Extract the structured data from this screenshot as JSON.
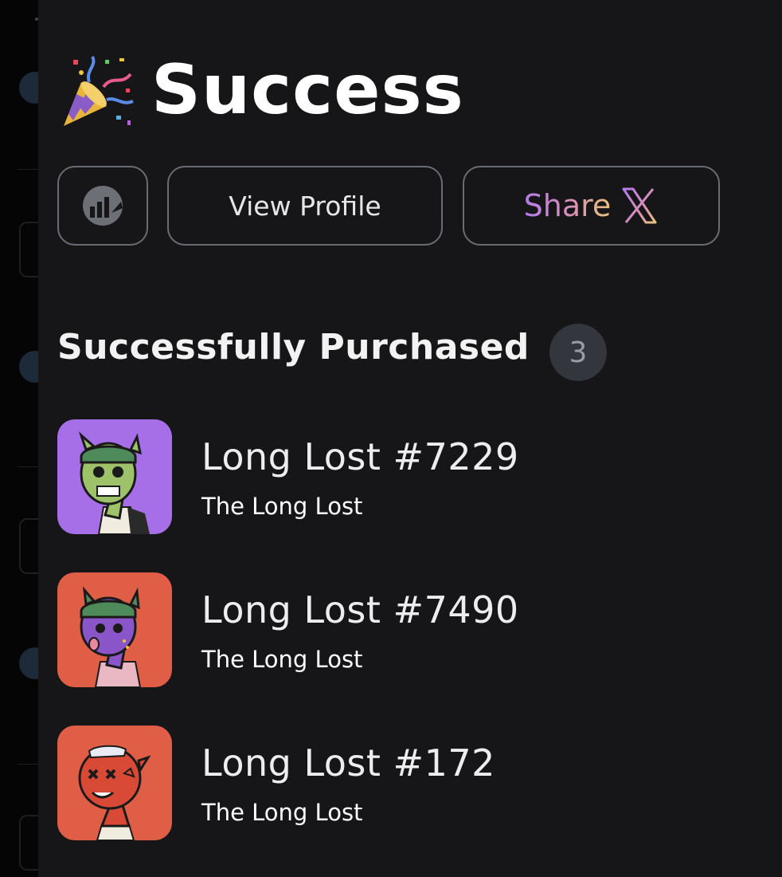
{
  "header": {
    "title": "Success",
    "title_icon": "party-popper-icon"
  },
  "actions": {
    "stats_icon": "chart-icon",
    "view_profile_label": "View Profile",
    "share_label": "Share",
    "share_icon": "x-logo-icon"
  },
  "purchased": {
    "section_title": "Successfully Purchased",
    "count": "3",
    "items": [
      {
        "name": "Long Lost #7229",
        "collection": "The Long Lost",
        "bg_color": "#a66fe8"
      },
      {
        "name": "Long Lost #7490",
        "collection": "The Long Lost",
        "bg_color": "#e05e45"
      },
      {
        "name": "Long Lost #172",
        "collection": "The Long Lost",
        "bg_color": "#e05e45"
      }
    ]
  },
  "colors": {
    "panel_bg": "#161618",
    "button_border": "#6a6c74",
    "badge_bg": "#34363d"
  }
}
